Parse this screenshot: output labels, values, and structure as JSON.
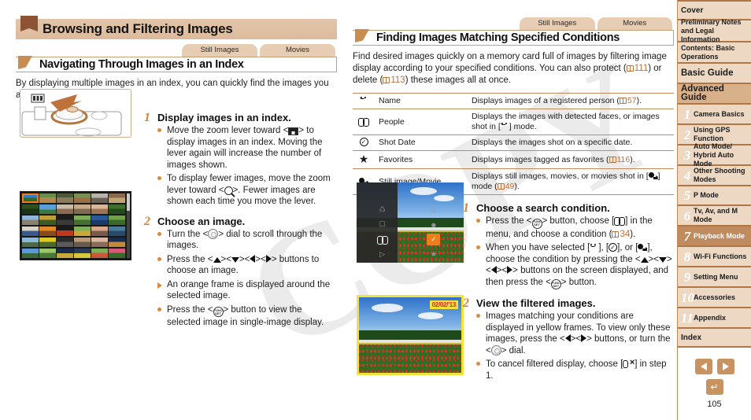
{
  "chapter": {
    "title": "Browsing and Filtering Images"
  },
  "left": {
    "tabs": [
      {
        "label": "Still Images"
      },
      {
        "label": "Movies"
      }
    ],
    "section_title": "Navigating Through Images in an Index",
    "intro": "By displaying multiple images in an index, you can quickly find the images you are looking for.",
    "steps": [
      {
        "num": "1",
        "title": "Display images in an index.",
        "bullets": [
          {
            "type": "dot",
            "pre": "Move the zoom lever toward <",
            "icon": "index-display-icon",
            "post": "> to display images in an index. Moving the lever again will increase the number of images shown."
          },
          {
            "type": "dot",
            "pre": "To display fewer images, move the zoom lever toward <",
            "icon": "magnify-icon",
            "post": ">. Fewer images are shown each time you move the lever."
          }
        ]
      },
      {
        "num": "2",
        "title": "Choose an image.",
        "bullets": [
          {
            "type": "dot",
            "pre": "Turn the <",
            "icon": "control-dial-icon",
            "post": "> dial to scroll through the images."
          },
          {
            "type": "dot",
            "pre": "Press the <",
            "icon": "updown-leftright-icon",
            "post": "> buttons to choose an image."
          },
          {
            "type": "tri",
            "pre": "An orange frame is displayed around the selected image.",
            "icon": "",
            "post": ""
          },
          {
            "type": "dot",
            "pre": "Press the <",
            "icon": "func-set-icon",
            "post": "> button to view the selected image in single-image display."
          }
        ]
      }
    ],
    "figures": {
      "camera_zoom_lever": "camera-zoom-lever-illustration",
      "index_screen": "index-thumbnail-grid-screenshot"
    }
  },
  "right": {
    "tabs": [
      {
        "label": "Still Images"
      },
      {
        "label": "Movies"
      }
    ],
    "section_title": "Finding Images Matching Specified Conditions",
    "intro_part1": "Find desired images quickly on a memory card full of images by filtering image display according to your specified conditions. You can also protect (",
    "intro_ref1": "111",
    "intro_part2": ") or delete (",
    "intro_ref2": "113",
    "intro_part3": ") these images all at once.",
    "table": {
      "rows": [
        {
          "icon": "name-face-icon",
          "label": "Name",
          "desc_pre": "Displays images of a registered person (",
          "desc_ref": "57",
          "desc_post": ")."
        },
        {
          "icon": "people-faces-icon",
          "label": "People",
          "desc_pre": "Displays the images with detected faces, or images shot in [",
          "desc_ref": "",
          "desc_post": "] mode."
        },
        {
          "icon": "shot-date-icon",
          "label": "Shot Date",
          "desc_pre": "Displays the images shot on a specific date.",
          "desc_ref": "",
          "desc_post": ""
        },
        {
          "icon": "favorites-star-icon",
          "label": "Favorites",
          "desc_pre": "Displays images tagged as favorites (",
          "desc_ref": "116",
          "desc_post": ")."
        },
        {
          "icon": "still-movie-icon",
          "label": "Still image/Movie",
          "desc_pre": "Displays still images, movies, or movies shot in [",
          "desc_ref": "49",
          "desc_post": "] mode (",
          "desc_tail": ")."
        }
      ]
    },
    "steps": [
      {
        "num": "1",
        "title": "Choose a search condition.",
        "bullets": [
          {
            "type": "dot",
            "text": "Press the <FUNC. SET> button, choose [binoculars] in the menu, and choose a condition (34)."
          },
          {
            "type": "dot",
            "text": "When you have selected [Name], [Shot Date], or [Still image/Movie], choose the condition by pressing the <up><down><left><right> buttons on the screen displayed, and then press the <FUNC. SET> button."
          }
        ]
      },
      {
        "num": "2",
        "title": "View the filtered images.",
        "bullets": [
          {
            "type": "dot",
            "text": "Images matching your conditions are displayed in yellow frames. To view only these images, press the <left><right> buttons, or turn the <dial> dial."
          },
          {
            "type": "dot",
            "text": "To cancel filtered display, choose [cancel-filter] in step 1."
          }
        ]
      }
    ],
    "ref_34": "34",
    "figures": {
      "menu_screen": "filter-menu-screenshot",
      "filtered_screen": "filtered-image-screenshot"
    },
    "date_badge": "02/02/'13"
  },
  "sidebar": {
    "items": [
      {
        "num": "",
        "label": "Cover",
        "style": "plain"
      },
      {
        "num": "",
        "label": "Preliminary Notes and Legal Information",
        "style": "plain"
      },
      {
        "num": "",
        "label": "Contents: Basic Operations",
        "style": "plain"
      },
      {
        "num": "",
        "label": "Basic Guide",
        "style": "big"
      },
      {
        "num": "",
        "label": "Advanced Guide",
        "style": "accent"
      },
      {
        "num": "1",
        "label": "Camera Basics",
        "style": "num"
      },
      {
        "num": "2",
        "label": "Using GPS Function",
        "style": "num"
      },
      {
        "num": "3",
        "label": "Auto Mode/ Hybrid Auto Mode",
        "style": "num"
      },
      {
        "num": "4",
        "label": "Other Shooting Modes",
        "style": "num"
      },
      {
        "num": "5",
        "label": "P Mode",
        "style": "num"
      },
      {
        "num": "6",
        "label": "Tv, Av, and M Mode",
        "style": "num"
      },
      {
        "num": "7",
        "label": "Playback Mode",
        "style": "active"
      },
      {
        "num": "8",
        "label": "Wi-Fi Functions",
        "style": "num"
      },
      {
        "num": "9",
        "label": "Setting Menu",
        "style": "num"
      },
      {
        "num": "10",
        "label": "Accessories",
        "style": "num"
      },
      {
        "num": "11",
        "label": "Appendix",
        "style": "num"
      },
      {
        "num": "",
        "label": "Index",
        "style": "plain"
      }
    ],
    "nav": {
      "prev": "previous-page-icon",
      "next": "next-page-icon",
      "back": "back-icon"
    },
    "page_number": "105"
  },
  "watermark": {
    "text": "COPY"
  },
  "colors": {
    "accent_brown": "#b07645",
    "tab_tan": "#e6cdb4",
    "orange": "#d98b3e",
    "ref_orange": "#c0703a",
    "sidebar_bg": "#ecd8c3",
    "sidebar_active": "#c08b5f",
    "yellow_frame": "#f2e23a"
  }
}
